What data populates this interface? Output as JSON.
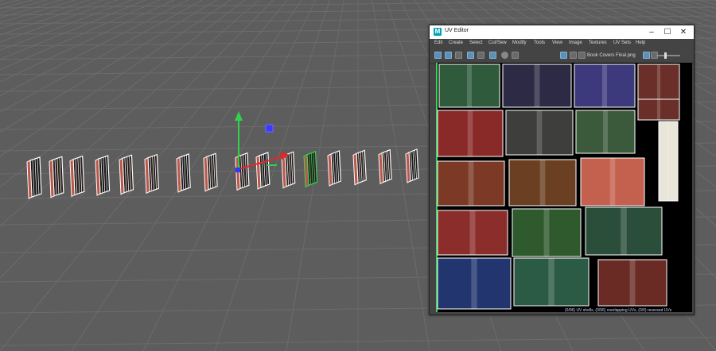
{
  "uv_editor": {
    "window_title": "UV Editor",
    "app_icon_letter": "M",
    "controls": {
      "minimize": "–",
      "maximize": "☐",
      "close": "✕"
    },
    "menu": [
      "Edit",
      "Create",
      "Select",
      "Cut/Sew",
      "Modify",
      "Tools",
      "View",
      "Image",
      "Textures",
      "UV Sets",
      "Help"
    ],
    "texture_name": "Book Covers Final.png",
    "status": "(0/96) UV shells, (0/96) overlapping UVs, (0/0) reversed UVs"
  },
  "colors": {
    "viewport_bg": "#5d5d5d",
    "grid_line": "#6c6c6c",
    "selected_highlight": "#39d65a",
    "uv_shell_border": "#ffffff"
  },
  "icons": [
    "move-y-arrow-icon",
    "move-x-arrow-icon",
    "move-z-arrow-icon",
    "center-handle-icon"
  ]
}
